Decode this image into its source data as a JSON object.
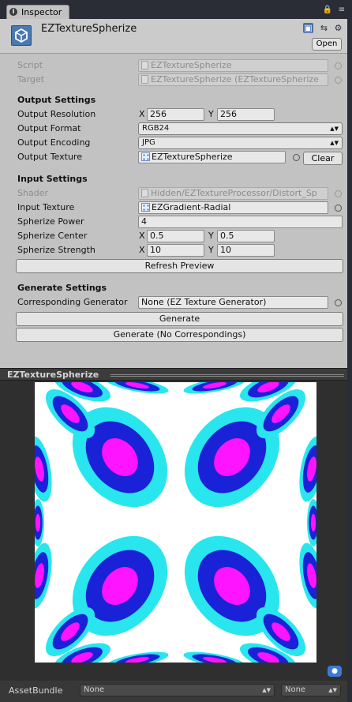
{
  "tab": {
    "label": "Inspector"
  },
  "header": {
    "title": "EZTextureSpherize",
    "open_label": "Open"
  },
  "script_row": {
    "label": "Script",
    "value": "EZTextureSpherize"
  },
  "target_row": {
    "label": "Target",
    "value": "EZTextureSpherize (EZTextureSpherize"
  },
  "output": {
    "heading": "Output Settings",
    "resolution": {
      "label": "Output Resolution",
      "x_label": "X",
      "x": "256",
      "y_label": "Y",
      "y": "256"
    },
    "format": {
      "label": "Output Format",
      "value": "RGB24"
    },
    "encoding": {
      "label": "Output Encoding",
      "value": "JPG"
    },
    "texture": {
      "label": "Output Texture",
      "value": "EZTextureSpherize",
      "clear_label": "Clear"
    }
  },
  "input": {
    "heading": "Input Settings",
    "shader": {
      "label": "Shader",
      "value": "Hidden/EZTextureProcessor/Distort_Sp"
    },
    "texture": {
      "label": "Input Texture",
      "value": "EZGradient-Radial"
    },
    "power": {
      "label": "Spherize Power",
      "value": "4"
    },
    "center": {
      "label": "Spherize Center",
      "x_label": "X",
      "x": "0.5",
      "y_label": "Y",
      "y": "0.5"
    },
    "strength": {
      "label": "Spherize Strength",
      "x_label": "X",
      "x": "10",
      "y_label": "Y",
      "y": "10"
    },
    "refresh_label": "Refresh Preview"
  },
  "generate": {
    "heading": "Generate Settings",
    "generator": {
      "label": "Corresponding Generator",
      "value": "None (EZ Texture Generator)"
    },
    "generate_label": "Generate",
    "generate_none_label": "Generate (No Correspondings)"
  },
  "preview": {
    "title": "EZTextureSpherize"
  },
  "footer": {
    "label": "AssetBundle",
    "bundle_value": "None",
    "variant_value": "None"
  },
  "colors": {
    "cyan": "#29e6ee",
    "blue": "#1a22d8",
    "magenta": "#ff14ff",
    "panel": "#c2c2c2"
  }
}
